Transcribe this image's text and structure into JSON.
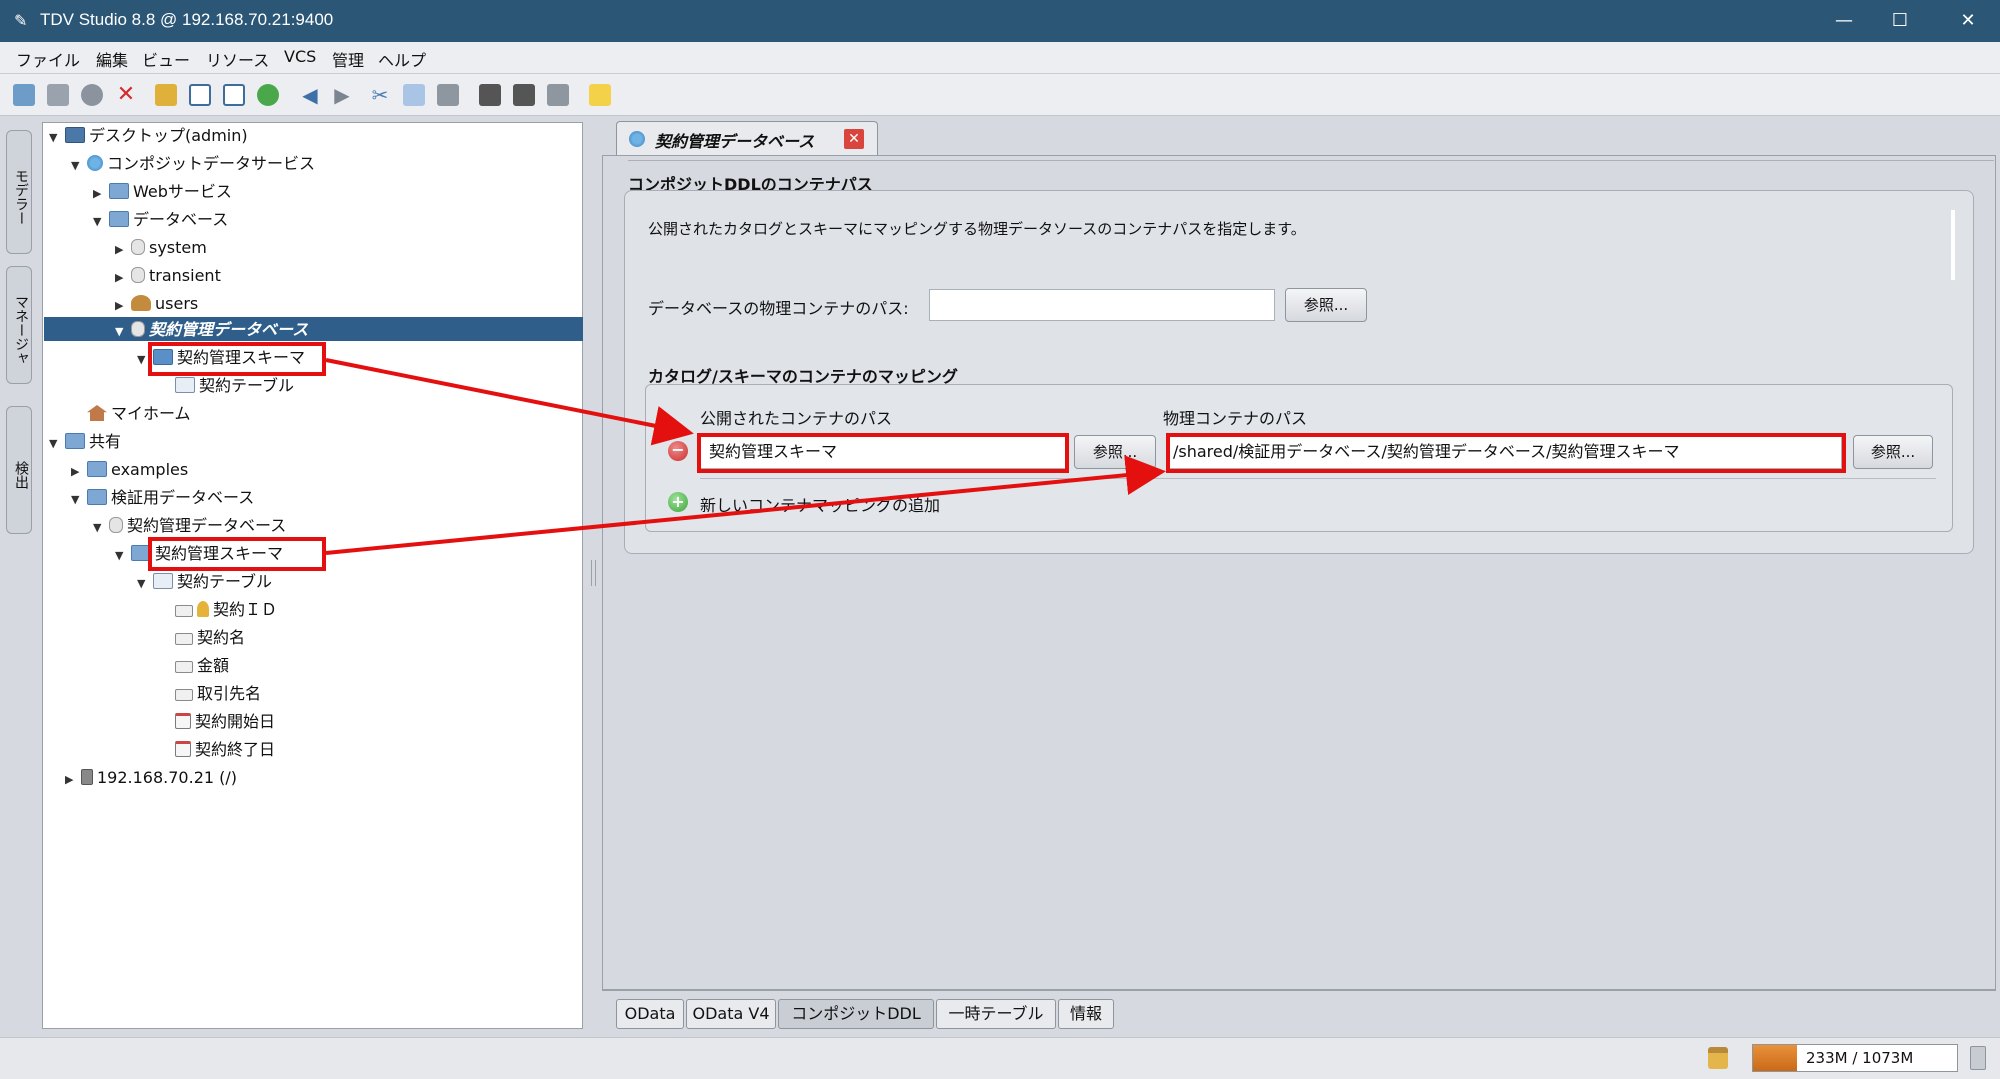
{
  "window": {
    "title": "TDV Studio 8.8 @ 192.168.70.21:9400",
    "minimize": "—",
    "maximize": "☐",
    "close": "✕"
  },
  "menu": [
    "ファイル",
    "編集",
    "ビュー",
    "リソース",
    "VCS",
    "管理",
    "ヘルプ"
  ],
  "side_tabs": [
    "モデラー",
    "マネージャ",
    "検出"
  ],
  "tree": {
    "items": [
      {
        "label": "デスクトップ(admin)",
        "icon": "desktop-icon"
      },
      {
        "label": "コンポジットデータサービス",
        "icon": "globe-icon"
      },
      {
        "label": "Webサービス",
        "icon": "folder-icon"
      },
      {
        "label": "データベース",
        "icon": "folder-icon"
      },
      {
        "label": "system",
        "icon": "db-icon"
      },
      {
        "label": "transient",
        "icon": "db-icon"
      },
      {
        "label": "users",
        "icon": "users-icon"
      },
      {
        "label": "契約管理データベース",
        "icon": "db-icon"
      },
      {
        "label": "契約管理スキーマ",
        "icon": "schema-icon"
      },
      {
        "label": "契約テーブル",
        "icon": "table-icon"
      },
      {
        "label": "マイホーム",
        "icon": "home-icon"
      },
      {
        "label": "共有",
        "icon": "folder-icon"
      },
      {
        "label": "examples",
        "icon": "folder-icon"
      },
      {
        "label": "検証用データベース",
        "icon": "folder-icon"
      },
      {
        "label": "契約管理データベース",
        "icon": "db-icon"
      },
      {
        "label": "契約管理スキーマ",
        "icon": "folder-icon"
      },
      {
        "label": "契約テーブル",
        "icon": "table-icon"
      },
      {
        "label": "契約ＩＤ",
        "icon": "key-column-icon"
      },
      {
        "label": "契約名",
        "icon": "column-icon"
      },
      {
        "label": "金額",
        "icon": "column-icon"
      },
      {
        "label": "取引先名",
        "icon": "column-icon"
      },
      {
        "label": "契約開始日",
        "icon": "date-column-icon"
      },
      {
        "label": "契約終了日",
        "icon": "date-column-icon"
      },
      {
        "label": "192.168.70.21 (/)",
        "icon": "server-icon"
      }
    ]
  },
  "editor": {
    "tab_label": "契約管理データベース",
    "tab_close": "✕",
    "section_title": "コンポジットDDLのコンテナパス",
    "description": "公開されたカタログとスキーマにマッピングする物理データソースのコンテナパスを指定します。",
    "physical_path_label": "データベースの物理コンテナのパス:",
    "physical_path_value": "",
    "browse_label": "参照...",
    "mapping_title": "カタログ/スキーマのコンテナのマッピング",
    "published_header": "公開されたコンテナのパス",
    "physical_header": "物理コンテナのパス",
    "mapping": {
      "published_path": "契約管理スキーマ",
      "physical_path": "/shared/検証用データベース/契約管理データベース/契約管理スキーマ"
    },
    "remove_symbol": "−",
    "add_symbol": "+",
    "add_mapping_label": "新しいコンテナマッピングの追加"
  },
  "bottom_tabs": [
    "OData",
    "OData V4",
    "コンポジットDDL",
    "一時テーブル",
    "情報"
  ],
  "active_bottom_tab": "コンポジットDDL",
  "status": {
    "memory": "233M / 1073M",
    "memory_used_fraction": 0.217
  },
  "colors": {
    "titlebar": "#2b5676",
    "selection": "#2f5e8a",
    "highlight": "#e41010"
  }
}
